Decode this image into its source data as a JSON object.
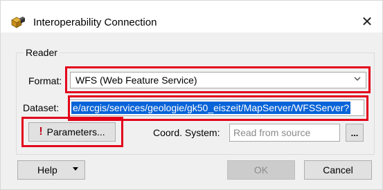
{
  "window": {
    "title": "Interoperability Connection",
    "close_glyph": "✕"
  },
  "reader": {
    "group_label": "Reader",
    "format_label": "Format:",
    "format_value": "WFS (Web Feature Service)",
    "dataset_label": "Dataset:",
    "dataset_value": "e/arcgis/services/geologie/gk50_eiszeit/MapServer/WFSServer?",
    "parameters_label": "Parameters...",
    "parameters_warning_icon": "exclamation-icon",
    "coord_system_label": "Coord. System:",
    "coord_system_placeholder": "Read from source",
    "browse_label": "..."
  },
  "footer": {
    "help_label": "Help",
    "ok_label": "OK",
    "cancel_label": "Cancel"
  },
  "colors": {
    "highlight": "#e2001a",
    "selection": "#0a64d8",
    "warning": "#c0001a"
  }
}
